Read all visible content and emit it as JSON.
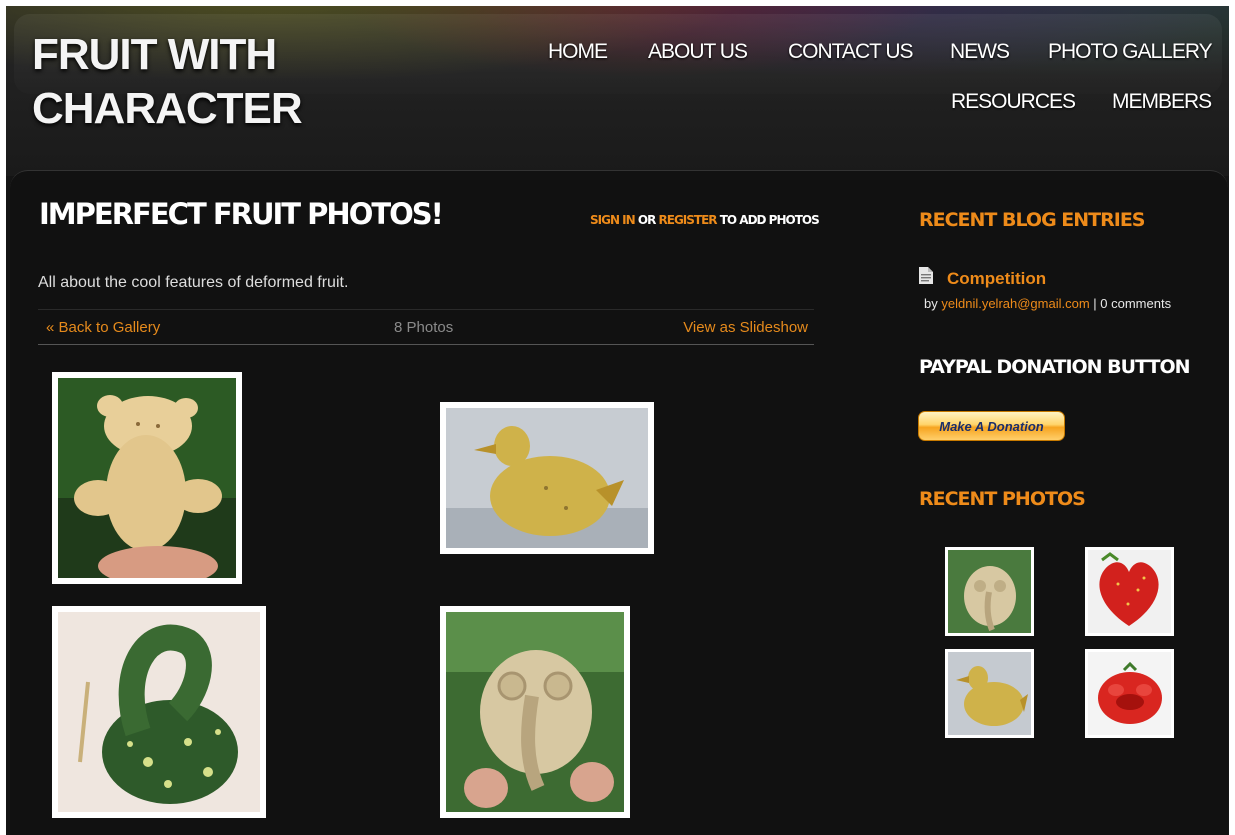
{
  "site": {
    "title": "FRUIT WITH CHARACTER"
  },
  "nav": {
    "home": "HOME",
    "about": "ABOUT US",
    "contact": "CONTACT US",
    "news": "NEWS",
    "gallery": "PHOTO GALLERY",
    "resources": "RESOURCES",
    "members": "MEMBERS"
  },
  "main": {
    "heading": "IMPERFECT FRUIT PHOTOS!",
    "auth": {
      "sign_in": "SIGN IN",
      "or": "OR",
      "register": "REGISTER",
      "suffix": "TO ADD PHOTOS"
    },
    "description": "All about the cool features of deformed fruit.",
    "gallery_bar": {
      "back": "« Back to Gallery",
      "count": "8 Photos",
      "slideshow": "View as Slideshow"
    },
    "photos": [
      "bear-shaped-potato",
      "duck-shaped-potato",
      "swan-shaped-gourd",
      "face-shaped-parsnip"
    ]
  },
  "sidebar": {
    "recent_blog_heading": "RECENT BLOG ENTRIES",
    "blog_entry": {
      "title": "Competition",
      "by": "by",
      "author": "yeldnil.yelrah@gmail.com",
      "comments": "| 0 comments",
      "icon": "document-icon"
    },
    "paypal_heading": "PAYPAL DONATION BUTTON",
    "donate_label": "Make A Donation",
    "recent_photos_heading": "RECENT PHOTOS",
    "recent_photos": [
      "face-parsnip",
      "heart-strawberry",
      "duck-potato",
      "lips-tomato"
    ]
  },
  "colors": {
    "accent": "#ee8b1a",
    "background": "#111111",
    "text": "#ffffff"
  }
}
